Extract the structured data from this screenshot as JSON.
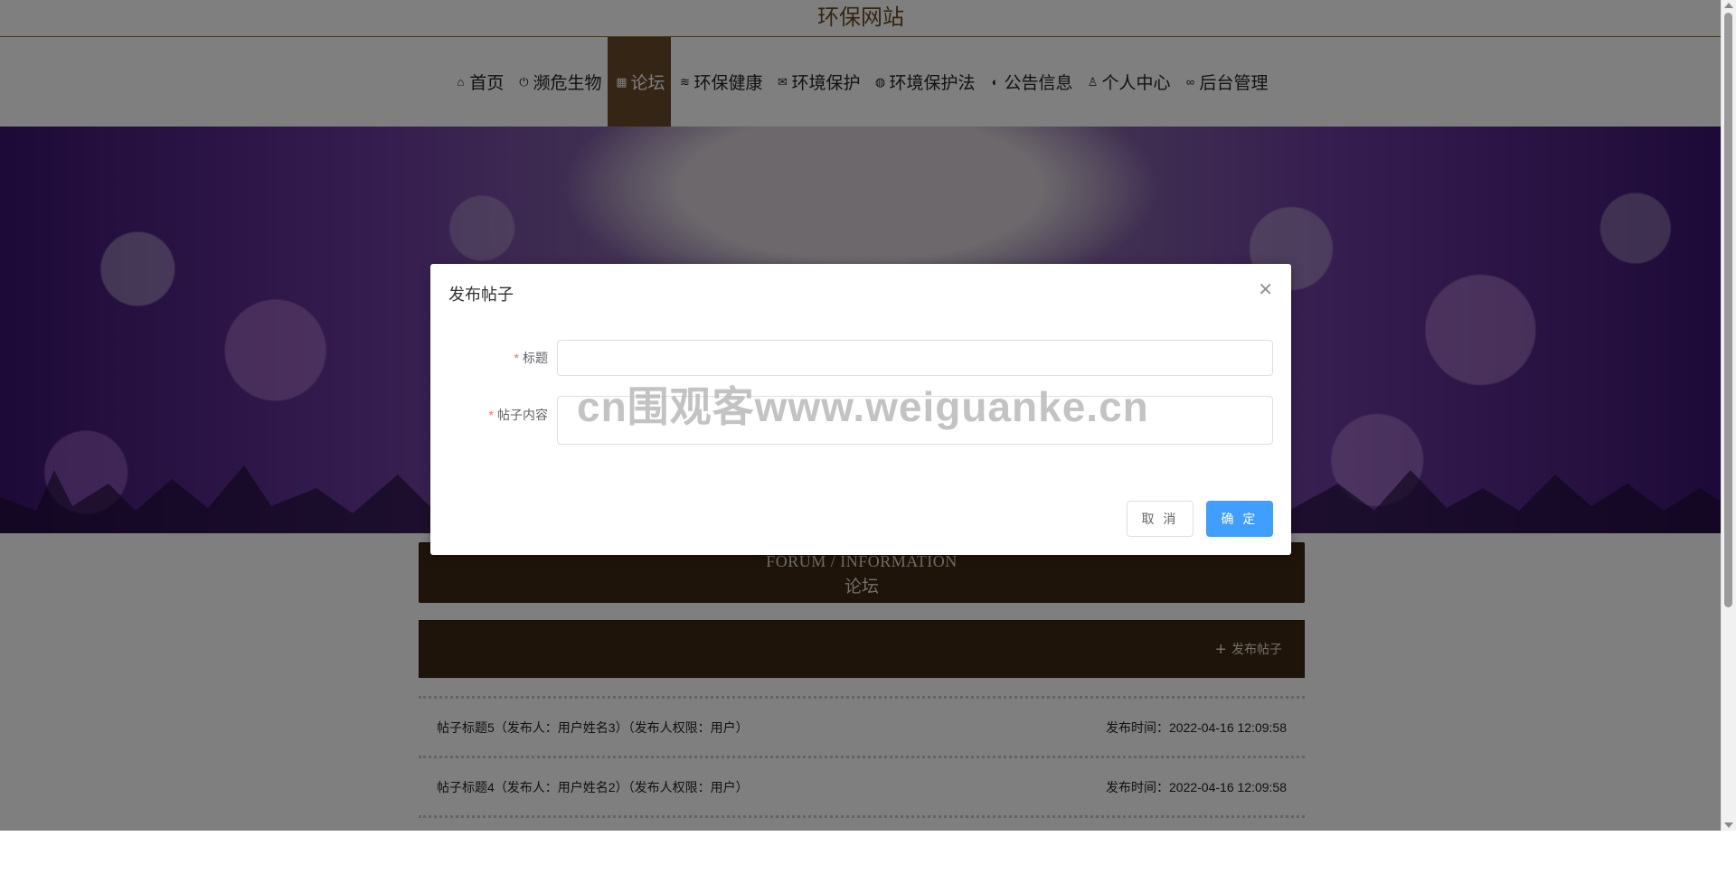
{
  "site": {
    "title": "环保网站"
  },
  "nav": [
    {
      "icon": "home-icon",
      "glyph": "⌂",
      "label": "首页"
    },
    {
      "icon": "power-icon",
      "glyph": "⏻",
      "label": "濒危生物"
    },
    {
      "icon": "grid-icon",
      "glyph": "▦",
      "label": "论坛",
      "active": true
    },
    {
      "icon": "layers-icon",
      "glyph": "≋",
      "label": "环保健康"
    },
    {
      "icon": "mail-icon",
      "glyph": "✉",
      "label": "环境保护"
    },
    {
      "icon": "globe-icon",
      "glyph": "◍",
      "label": "环境保护法"
    },
    {
      "icon": "palette-icon",
      "glyph": "◐",
      "label": "公告信息"
    },
    {
      "icon": "user-icon",
      "glyph": "♙",
      "label": "个人中心"
    },
    {
      "icon": "link-icon",
      "glyph": "∞",
      "label": "后台管理"
    }
  ],
  "section": {
    "title_en": "FORUM / INFORMATION",
    "title_zh": "论坛"
  },
  "publish": {
    "label": "发布帖子"
  },
  "posts": [
    {
      "title": "帖子标题5（发布人：用户姓名3）（发布人权限：用户）",
      "date": "发布时间：2022-04-16 12:09:58"
    },
    {
      "title": "帖子标题4（发布人：用户姓名2）（发布人权限：用户）",
      "date": "发布时间：2022-04-16 12:09:58"
    }
  ],
  "dialog": {
    "title": "发布帖子",
    "fields": {
      "title_label": "标题",
      "content_label": "帖子内容",
      "title_value": "",
      "content_value": ""
    },
    "buttons": {
      "cancel": "取 消",
      "confirm": "确 定"
    }
  },
  "watermark": "cn围观客www.weiguanke.cn",
  "colors": {
    "brand": "#6b4a2a",
    "primary": "#409eff",
    "section_bg": "#3c2814"
  }
}
